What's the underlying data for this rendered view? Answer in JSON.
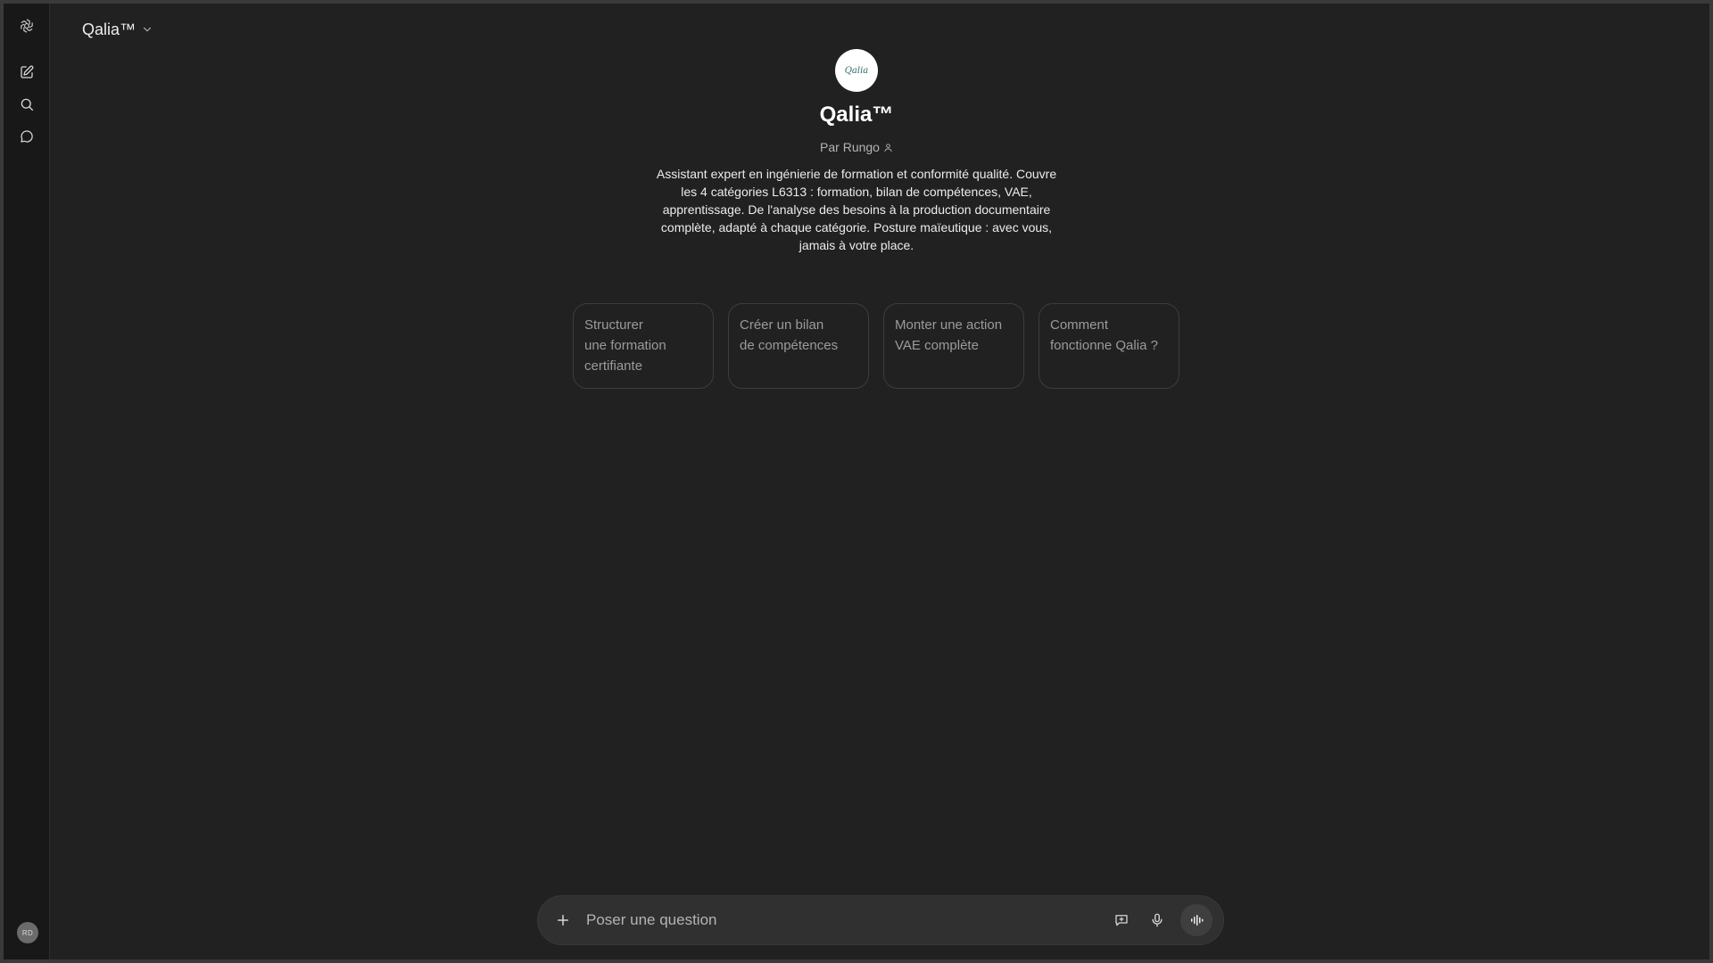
{
  "header": {
    "model_name": "Qalia™"
  },
  "gpt": {
    "logo_text": "Qalia",
    "title": "Qalia™",
    "author": "Par Rungo",
    "description": "Assistant expert en ingénierie de formation et conformité qualité. Couvre les 4 catégories L6313 : formation, bilan de compétences, VAE, apprentissage. De l'analyse des besoins à la production documentaire complète, adapté à chaque catégorie. Posture maïeutique : avec vous, jamais à votre place."
  },
  "starters": [
    {
      "label": "Structurer\nune formation\ncertifiante"
    },
    {
      "label": "Créer un bilan\nde compétences"
    },
    {
      "label": "Monter une action\nVAE complète"
    },
    {
      "label": "Comment\nfonctionne Qalia ?"
    }
  ],
  "composer": {
    "placeholder": "Poser une question"
  },
  "user": {
    "initials": "RD"
  },
  "icons": {
    "logo": "openai-logo-icon",
    "new_chat": "compose-icon",
    "search": "search-icon",
    "chats": "chat-bubble-icon",
    "plus": "plus-icon",
    "tools": "message-plus-icon",
    "mic": "microphone-icon",
    "voice": "voice-waveform-icon"
  }
}
